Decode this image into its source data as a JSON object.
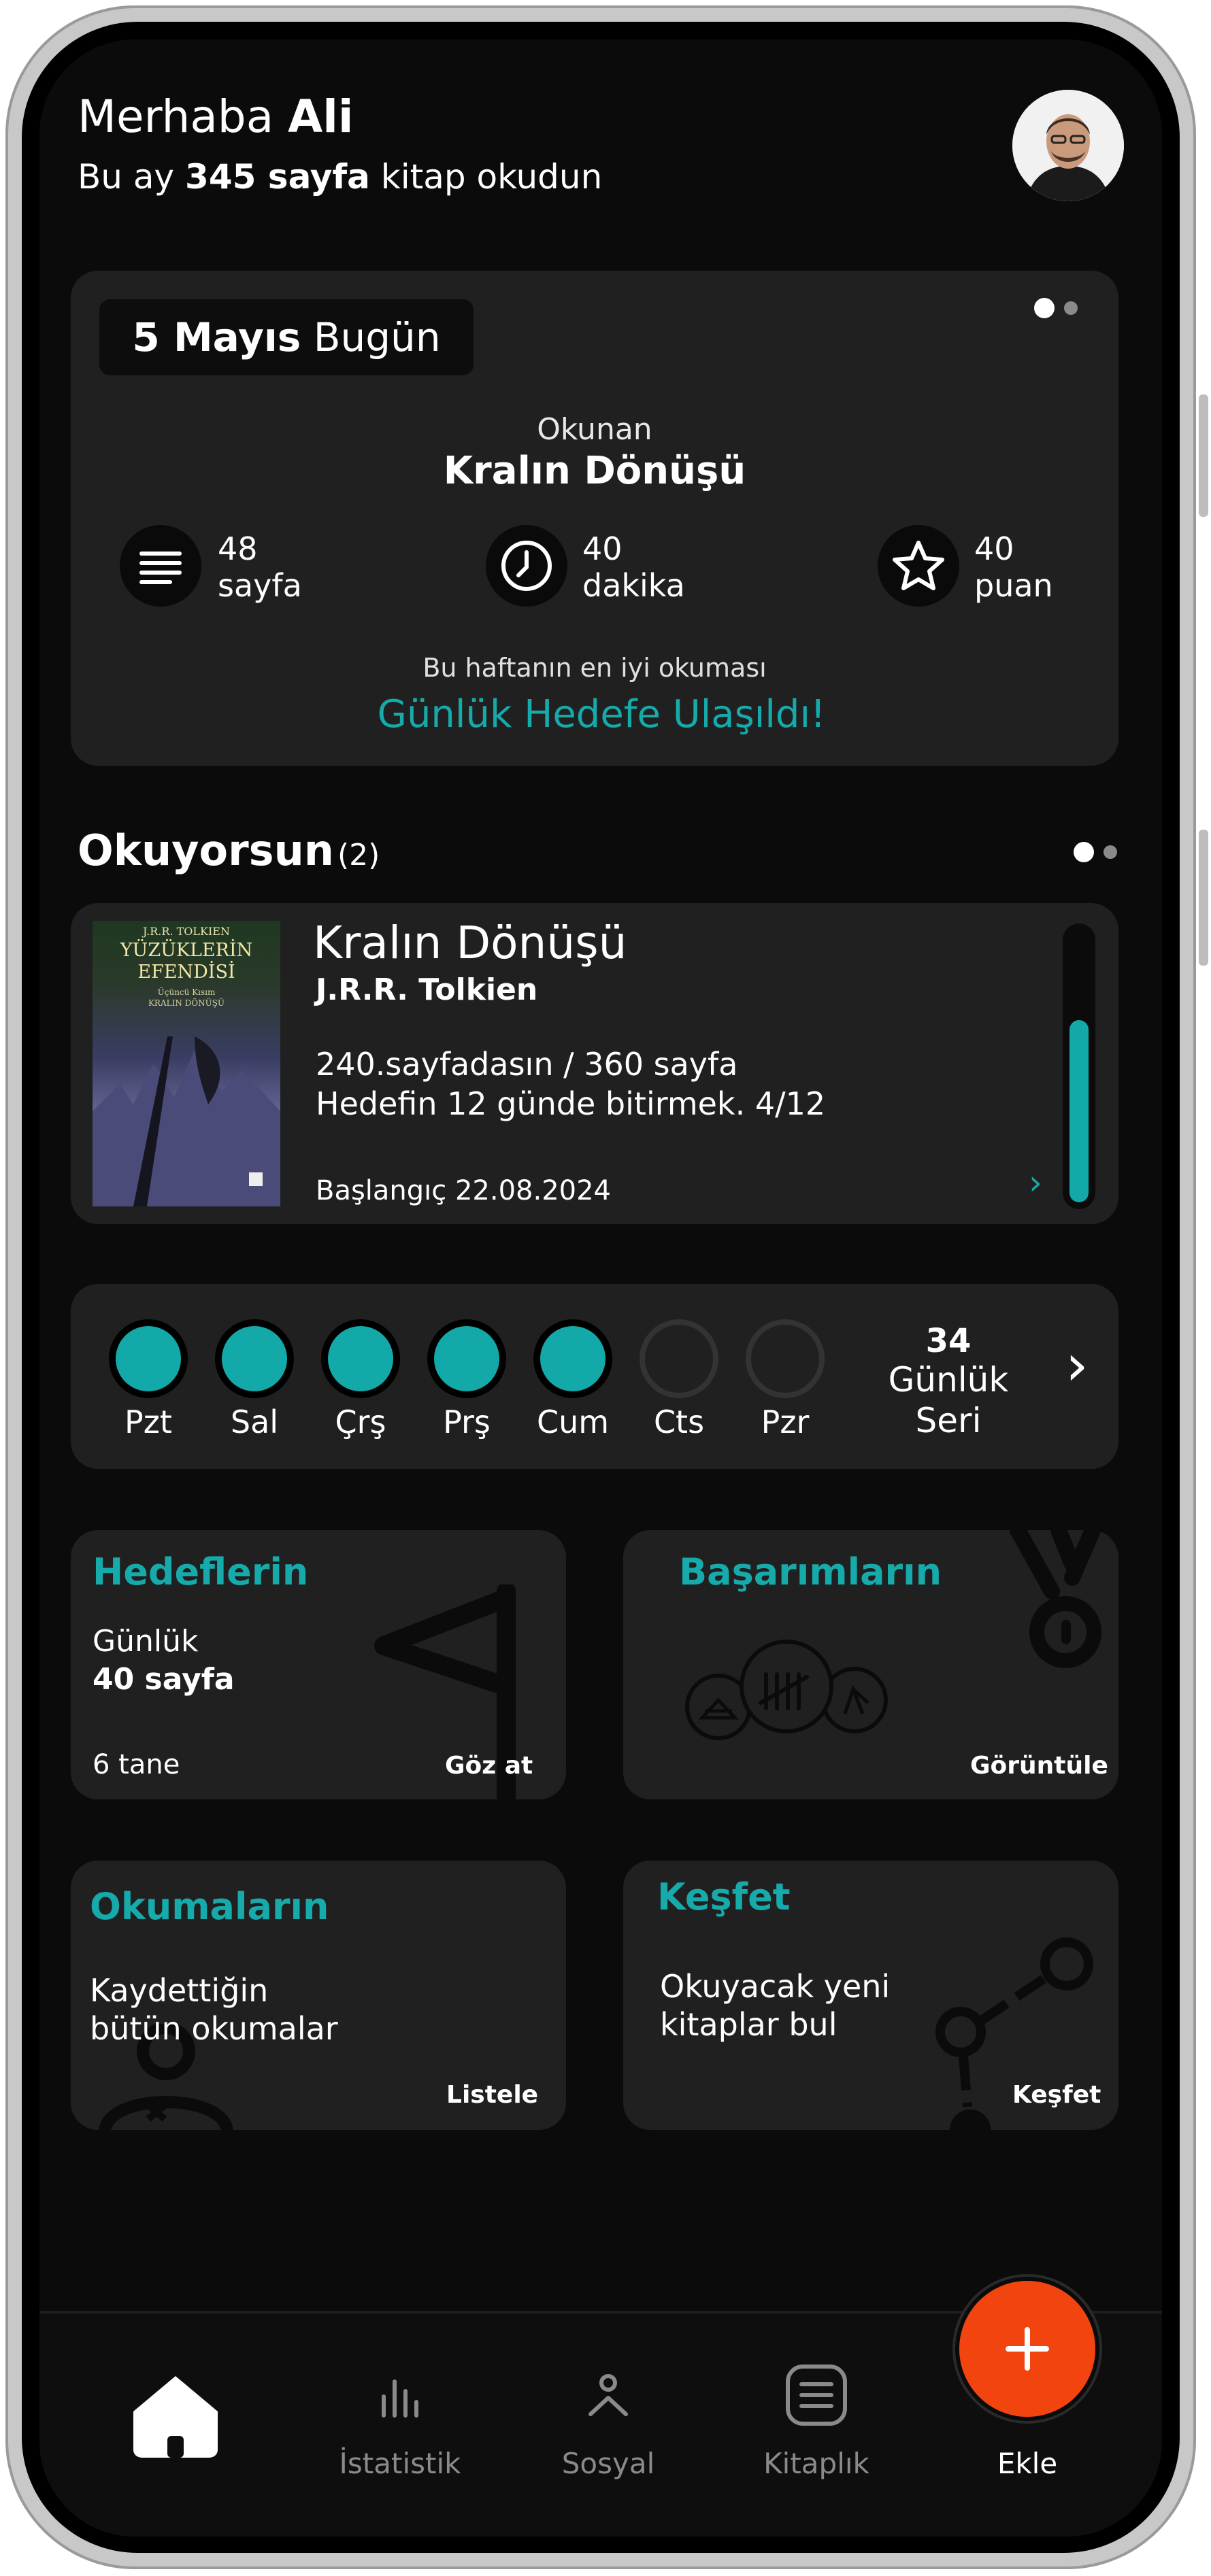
{
  "header": {
    "greeting": "Merhaba",
    "name": "Ali",
    "subtitle_prefix": "Bu ay",
    "subtitle_bold": "345 sayfa",
    "subtitle_suffix": "kitap okudun"
  },
  "today_card": {
    "date_bold": "5 Mayıs",
    "date_rest": "Bugün",
    "reading_label": "Okunan",
    "book_title": "Kralın Dönüşü",
    "stats": [
      {
        "icon": "lines-icon",
        "value": "48",
        "unit": "sayfa"
      },
      {
        "icon": "clock-icon",
        "value": "40",
        "unit": "dakika"
      },
      {
        "icon": "star-icon",
        "value": "40",
        "unit": "puan"
      }
    ],
    "best_label": "Bu haftanın en iyi okuması",
    "goal_text": "Günlük Hedefe Ulaşıldı!"
  },
  "reading": {
    "title": "Okuyorsun",
    "count": "(2)",
    "book": {
      "cover_author": "J.R.R. TOLKIEN",
      "cover_series_line1": "YÜZÜKLERİN",
      "cover_series_line2": "EFENDİSİ",
      "cover_subtitle": "Üçüncü Kısım",
      "cover_book": "KRALIN DÖNÜŞÜ",
      "title": "Kralın Dönüşü",
      "author": "J.R.R. Tolkien",
      "progress_text": "240.sayfadasın / 360 sayfa",
      "goal_text": "Hedefin 12 günde bitirmek. 4/12",
      "start_text": "Başlangıç 22.08.2024",
      "progress_fraction": 0.67
    }
  },
  "week": {
    "days": [
      {
        "label": "Pzt",
        "done": true
      },
      {
        "label": "Sal",
        "done": true
      },
      {
        "label": "Çrş",
        "done": true
      },
      {
        "label": "Prş",
        "done": true
      },
      {
        "label": "Cum",
        "done": true
      },
      {
        "label": "Cts",
        "done": false
      },
      {
        "label": "Pzr",
        "done": false
      }
    ],
    "streak_number": "34",
    "streak_line1": "Günlük",
    "streak_line2": "Seri"
  },
  "tiles": {
    "goals": {
      "title": "Hedeflerin",
      "line1": "Günlük",
      "line2": "40 sayfa",
      "count": "6 tane",
      "action": "Göz at"
    },
    "achievements": {
      "title": "Başarımların",
      "action": "Görüntüle"
    },
    "readings": {
      "title": "Okumaların",
      "line1": "Kaydettiğin",
      "line2": "bütün okumalar",
      "action": "Listele"
    },
    "discover": {
      "title": "Keşfet",
      "line1": "Okuyacak yeni",
      "line2": "kitaplar bul",
      "action": "Keşfet"
    }
  },
  "nav": {
    "home": "",
    "stats": "İstatistik",
    "social": "Sosyal",
    "library": "Kitaplık",
    "add": "Ekle"
  },
  "colors": {
    "accent": "#16aaaa",
    "fab": "#f2440f",
    "background": "#0b0b0b",
    "card": "#202020"
  }
}
